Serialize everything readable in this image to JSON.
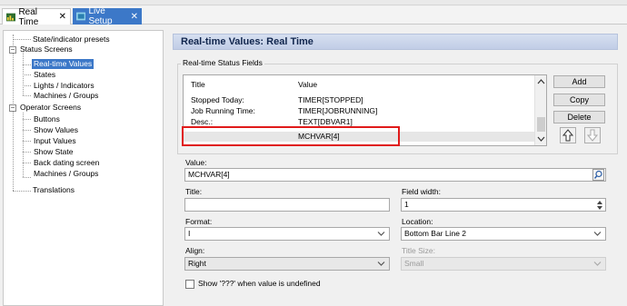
{
  "tabs": [
    {
      "label": "Real Time",
      "close": "✕"
    },
    {
      "label": "Live Setup",
      "close": "✕"
    }
  ],
  "tree": {
    "items": [
      {
        "label": "State/indicator presets"
      },
      {
        "label": "Status Screens"
      },
      {
        "label": "Real-time Values"
      },
      {
        "label": "States"
      },
      {
        "label": "Lights / Indicators"
      },
      {
        "label": "Machines / Groups"
      },
      {
        "label": "Operator Screens"
      },
      {
        "label": "Buttons"
      },
      {
        "label": "Show Values"
      },
      {
        "label": "Input Values"
      },
      {
        "label": "Show State"
      },
      {
        "label": "Back dating screen"
      },
      {
        "label": "Machines / Groups"
      },
      {
        "label": "Translations"
      }
    ],
    "expander_glyph": "−"
  },
  "panel": {
    "title": "Real-time Values: Real Time",
    "group_label": "Real-time Status Fields",
    "columns": {
      "title": "Title",
      "value": "Value"
    },
    "rows": [
      {
        "title": "Stopped Today:",
        "value": "TIMER[STOPPED]"
      },
      {
        "title": "Job Running Time:",
        "value": "TIMER[JOBRUNNING]"
      },
      {
        "title": "Desc.:",
        "value": "TEXT[DBVAR1]"
      },
      {
        "title": "",
        "value": "MCHVAR[4]"
      }
    ],
    "buttons": {
      "add": "Add",
      "copy": "Copy",
      "delete": "Delete"
    },
    "value_label": "Value:",
    "value": "MCHVAR[4]",
    "title_label": "Title:",
    "title_value": "",
    "field_width_label": "Field width:",
    "field_width": "1",
    "format_label": "Format:",
    "format_value": "I",
    "location_label": "Location:",
    "location_value": "Bottom Bar Line 2",
    "align_label": "Align:",
    "align_value": "Right",
    "title_size_label": "Title Size:",
    "title_size_value": "Small",
    "checkbox_label": "Show '???' when value is undefined"
  },
  "colors": {
    "accent": "#3c78c8",
    "highlight": "#e01a1a",
    "header_bg": "#c9d4ea"
  }
}
